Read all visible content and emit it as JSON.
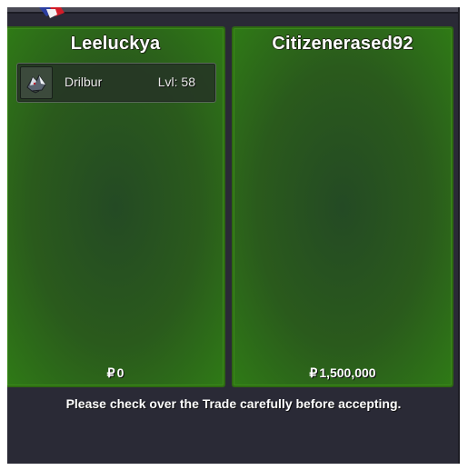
{
  "trade": {
    "left": {
      "player_name": "Leeluckya",
      "pokemon": [
        {
          "name": "Drilbur",
          "level": "Lvl: 58",
          "icon": "drilbur-sprite-icon"
        }
      ],
      "money": "0"
    },
    "right": {
      "player_name": "Citizenerased92",
      "pokemon": [],
      "money": "1,500,000"
    },
    "currency_symbol": "₽",
    "notice": "Please check over the Trade carefully before accepting."
  },
  "colors": {
    "panel_green": "#2f7a16",
    "background": "#2a2a36"
  }
}
